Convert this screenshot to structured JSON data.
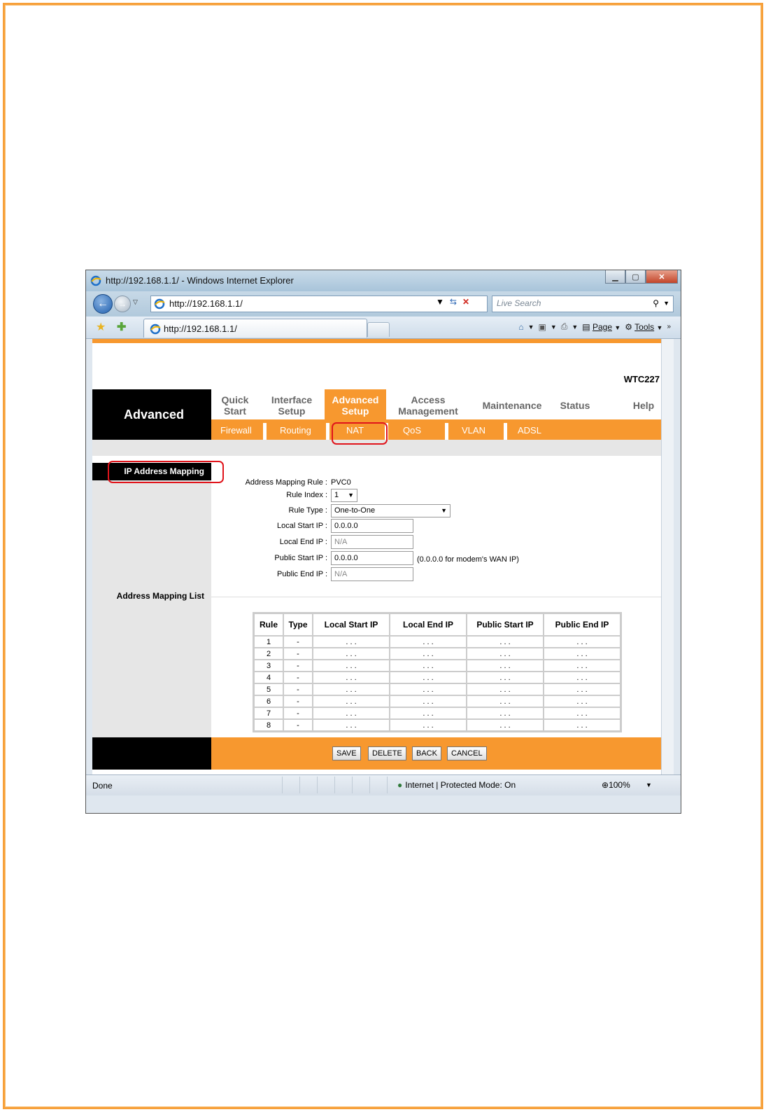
{
  "browser": {
    "window_title": "http://192.168.1.1/ - Windows Internet Explorer",
    "address": "http://192.168.1.1/",
    "search_placeholder": "Live Search",
    "tab_label": "http://192.168.1.1/",
    "tools": {
      "page": "Page",
      "tools": "Tools"
    },
    "status": {
      "left": "Done",
      "zone": "Internet | Protected Mode: On",
      "zoom": "100%"
    }
  },
  "router": {
    "model": "WTC227",
    "section_title": "Advanced",
    "menu": [
      {
        "line1": "Quick",
        "line2": "Start"
      },
      {
        "line1": "Interface",
        "line2": "Setup"
      },
      {
        "line1": "Advanced",
        "line2": "Setup"
      },
      {
        "line1": "Access",
        "line2": "Management"
      },
      {
        "line1": "Maintenance",
        "line2": ""
      },
      {
        "line1": "Status",
        "line2": ""
      },
      {
        "line1": "Help",
        "line2": ""
      }
    ],
    "submenu": [
      "Firewall",
      "Routing",
      "NAT",
      "QoS",
      "VLAN",
      "ADSL"
    ],
    "ip_mapping_title": "IP Address Mapping",
    "mapping_list_title": "Address Mapping List",
    "form": {
      "rule_label": "Address Mapping Rule :",
      "rule_value": "PVC0",
      "index_label": "Rule Index :",
      "index_value": "1",
      "type_label": "Rule Type :",
      "type_value": "One-to-One",
      "local_start_label": "Local Start IP :",
      "local_start_value": "0.0.0.0",
      "local_end_label": "Local End IP :",
      "local_end_value": "N/A",
      "public_start_label": "Public Start IP :",
      "public_start_value": "0.0.0.0",
      "public_start_hint": "(0.0.0.0 for modem's WAN IP)",
      "public_end_label": "Public End IP :",
      "public_end_value": "N/A"
    },
    "table": {
      "headers": [
        "Rule",
        "Type",
        "Local Start IP",
        "Local End IP",
        "Public Start IP",
        "Public End IP"
      ],
      "rows": [
        [
          "1",
          "-",
          ". . .",
          ". . .",
          ". . .",
          ". . ."
        ],
        [
          "2",
          "-",
          ". . .",
          ". . .",
          ". . .",
          ". . ."
        ],
        [
          "3",
          "-",
          ". . .",
          ". . .",
          ". . .",
          ". . ."
        ],
        [
          "4",
          "-",
          ". . .",
          ". . .",
          ". . .",
          ". . ."
        ],
        [
          "5",
          "-",
          ". . .",
          ". . .",
          ". . .",
          ". . ."
        ],
        [
          "6",
          "-",
          ". . .",
          ". . .",
          ". . .",
          ". . ."
        ],
        [
          "7",
          "-",
          ". . .",
          ". . .",
          ". . .",
          ". . ."
        ],
        [
          "8",
          "-",
          ". . .",
          ". . .",
          ". . .",
          ". . ."
        ]
      ]
    },
    "buttons": {
      "save": "SAVE",
      "delete": "DELETE",
      "back": "BACK",
      "cancel": "CANCEL"
    }
  },
  "colors": {
    "accent": "#f7982f",
    "annotation": "#e0141b",
    "frame": "#f7a03a"
  }
}
